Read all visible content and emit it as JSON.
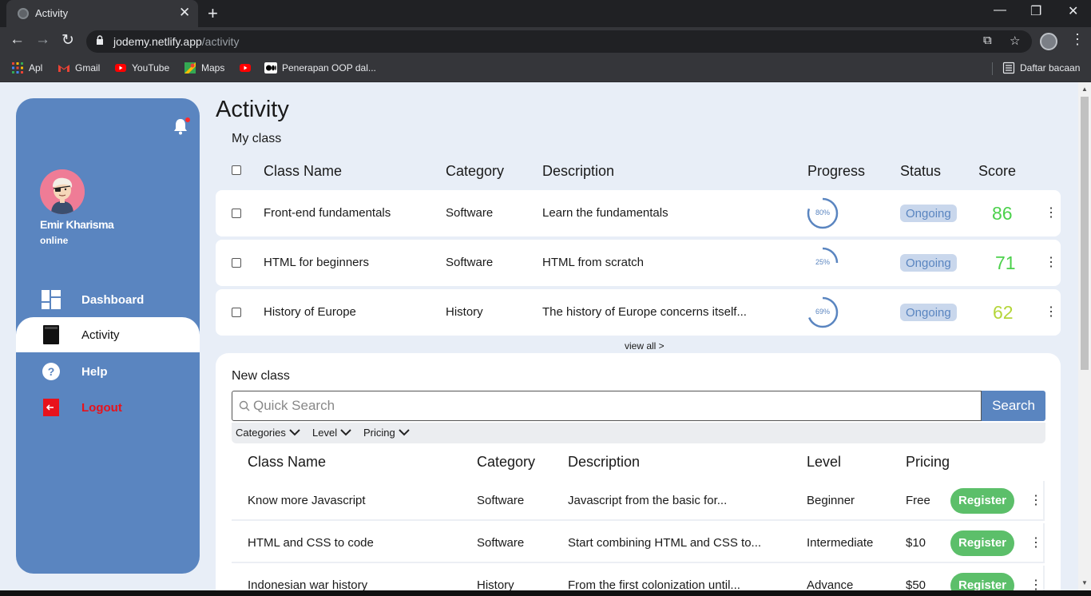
{
  "browser": {
    "tab_title": "Activity",
    "url_host": "jodemy.netlify.app",
    "url_path": "/activity",
    "bookmarks": [
      "Apl",
      "Gmail",
      "YouTube",
      "Maps",
      "",
      "Penerapan OOP dal..."
    ],
    "reading_list": "Daftar bacaan"
  },
  "sidebar": {
    "user_name": "Emir Kharisma",
    "user_status": "online",
    "nav": [
      {
        "label": "Dashboard",
        "icon": "dashboard-icon"
      },
      {
        "label": "Activity",
        "icon": "book-icon"
      },
      {
        "label": "Help",
        "icon": "help-icon"
      },
      {
        "label": "Logout",
        "icon": "logout-icon"
      }
    ]
  },
  "main": {
    "title": "Activity",
    "my_class": {
      "label": "My class",
      "headers": [
        "Class Name",
        "Category",
        "Description",
        "Progress",
        "Status",
        "Score"
      ],
      "rows": [
        {
          "name": "Front-end fundamentals",
          "category": "Software",
          "description": "Learn the fundamentals",
          "progress": 80,
          "progress_label": "80%",
          "status": "Ongoing",
          "score": "86",
          "score_color": "#4cd14c"
        },
        {
          "name": "HTML for beginners",
          "category": "Software",
          "description": "HTML from scratch",
          "progress": 25,
          "progress_label": "25%",
          "status": "Ongoing",
          "score": "71",
          "score_color": "#4cd14c"
        },
        {
          "name": "History of Europe",
          "category": "History",
          "description": "The history of Europe concerns itself...",
          "progress": 69,
          "progress_label": "69%",
          "status": "Ongoing",
          "score": "62",
          "score_color": "#b5d63a"
        }
      ],
      "view_all": "view all >"
    },
    "new_class": {
      "label": "New class",
      "search_placeholder": "Quick Search",
      "search_button": "Search",
      "filters": [
        "Categories",
        "Level",
        "Pricing"
      ],
      "headers": [
        "Class Name",
        "Category",
        "Description",
        "Level",
        "Pricing"
      ],
      "register_label": "Register",
      "rows": [
        {
          "name": "Know more Javascript",
          "category": "Software",
          "description": "Javascript from the basic for...",
          "level": "Beginner",
          "pricing": "Free"
        },
        {
          "name": "HTML and CSS to code",
          "category": "Software",
          "description": "Start combining HTML and CSS to...",
          "level": "Intermediate",
          "pricing": "$10"
        },
        {
          "name": "Indonesian war history",
          "category": "History",
          "description": "From the first colonization until...",
          "level": "Advance",
          "pricing": "$50"
        }
      ]
    }
  },
  "colors": {
    "sidebar": "#5a85c0",
    "accent": "#5a85c0",
    "register": "#5cbf6a",
    "logout": "#e8121b",
    "page_bg": "#e8eef7"
  }
}
